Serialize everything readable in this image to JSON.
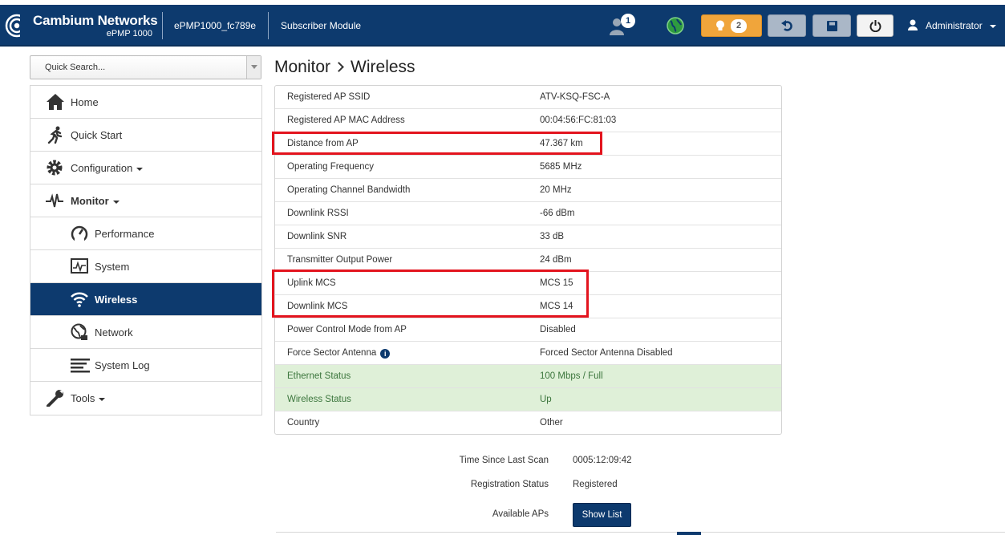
{
  "header": {
    "brand": "Cambium Networks",
    "model": "ePMP 1000",
    "device_name": "ePMP1000_fc789e",
    "mode": "Subscriber Module",
    "user_badge_count": "1",
    "alert_count": "2",
    "admin_label": "Administrator"
  },
  "sidebar": {
    "search_placeholder": "Quick Search...",
    "items": [
      {
        "label": "Home",
        "icon": "home-icon"
      },
      {
        "label": "Quick Start",
        "icon": "running-man-icon"
      },
      {
        "label": "Configuration",
        "icon": "gear-icon"
      },
      {
        "label": "Monitor",
        "icon": "pulse-icon"
      },
      {
        "label": "Performance",
        "icon": "gauge-icon"
      },
      {
        "label": "System",
        "icon": "system-monitor-icon"
      },
      {
        "label": "Wireless",
        "icon": "wifi-icon"
      },
      {
        "label": "Network",
        "icon": "network-globe-icon"
      },
      {
        "label": "System Log",
        "icon": "log-lines-icon"
      },
      {
        "label": "Tools",
        "icon": "wrench-icon"
      }
    ]
  },
  "breadcrumb": {
    "section": "Monitor",
    "page": "Wireless"
  },
  "wireless": {
    "rows": [
      {
        "key": "Registered AP SSID",
        "value": "ATV-KSQ-FSC-A"
      },
      {
        "key": "Registered AP MAC Address",
        "value": "00:04:56:FC:81:03"
      },
      {
        "key": "Distance from AP",
        "value": "47.367 km"
      },
      {
        "key": "Operating Frequency",
        "value": "5685 MHz"
      },
      {
        "key": "Operating Channel Bandwidth",
        "value": "20 MHz"
      },
      {
        "key": "Downlink RSSI",
        "value": "-66 dBm"
      },
      {
        "key": "Downlink SNR",
        "value": "33 dB"
      },
      {
        "key": "Transmitter Output Power",
        "value": "24 dBm"
      },
      {
        "key": "Uplink MCS",
        "value": "MCS 15"
      },
      {
        "key": "Downlink MCS",
        "value": "MCS 14"
      },
      {
        "key": "Power Control Mode from AP",
        "value": "Disabled"
      },
      {
        "key": "Force Sector Antenna",
        "value": "Forced Sector Antenna Disabled"
      },
      {
        "key": "Ethernet Status",
        "value": "100 Mbps / Full"
      },
      {
        "key": "Wireless Status",
        "value": "Up"
      },
      {
        "key": "Country",
        "value": "Other"
      }
    ]
  },
  "scan": {
    "time_label": "Time Since Last Scan",
    "time_value": "0005:12:09:42",
    "reg_label": "Registration Status",
    "reg_value": "Registered",
    "aps_label": "Available APs",
    "show_button": "Show List"
  },
  "colors": {
    "header_bg": "#0d3a6e",
    "active_nav": "#0d3a6e",
    "alert_button": "#f0a53b",
    "status_ok_bg": "#dff0d8",
    "highlight": "#e3141e"
  }
}
